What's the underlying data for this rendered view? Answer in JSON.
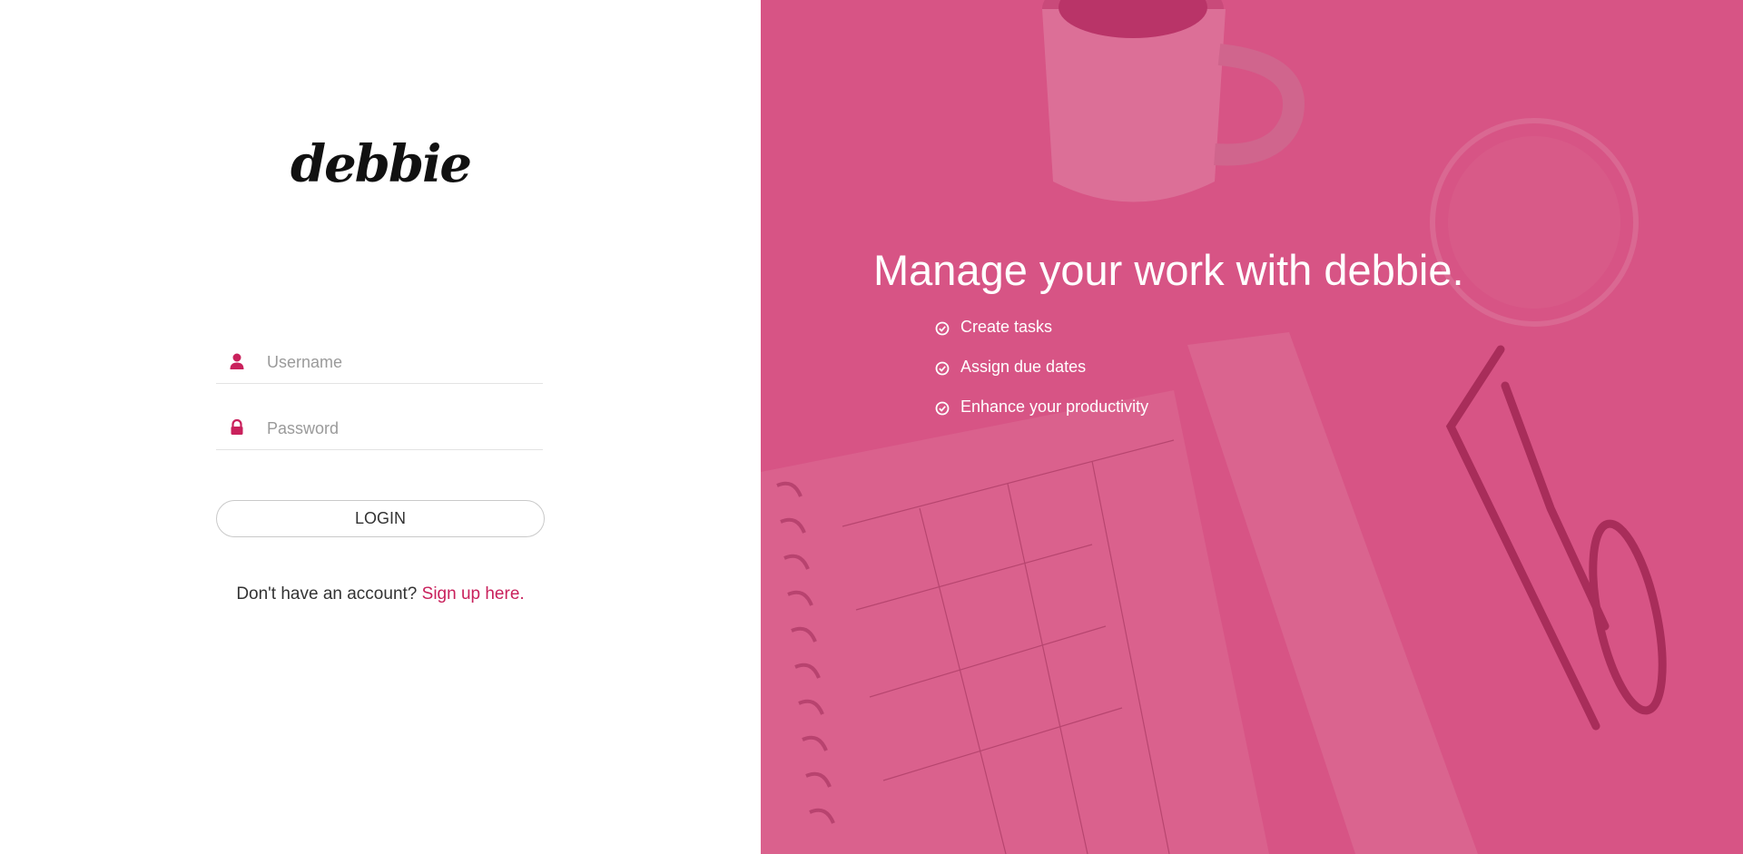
{
  "brand": {
    "logo_text": "debbie"
  },
  "login_form": {
    "username": {
      "placeholder": "Username",
      "value": "",
      "icon": "user-icon"
    },
    "password": {
      "placeholder": "Password",
      "value": "",
      "icon": "lock-icon"
    },
    "login_label": "LOGIN",
    "signup_prompt": "Don't have an account?",
    "signup_link": "Sign up here."
  },
  "hero": {
    "headline": "Manage your work with debbie.",
    "features": [
      "Create tasks",
      "Assign due dates",
      "Enhance your productivity"
    ],
    "feature_icon": "check-circle-icon"
  },
  "colors": {
    "accent": "#c9215c",
    "panel_overlay": "#d75485",
    "text_dark": "#333333"
  }
}
